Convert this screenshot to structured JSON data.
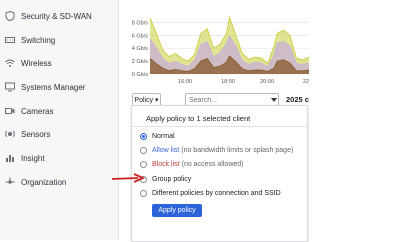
{
  "sidebar": {
    "items": [
      {
        "label": "Security & SD-WAN",
        "icon": "shield-icon"
      },
      {
        "label": "Switching",
        "icon": "switch-icon"
      },
      {
        "label": "Wireless",
        "icon": "wifi-icon"
      },
      {
        "label": "Systems Manager",
        "icon": "monitor-icon"
      },
      {
        "label": "Cameras",
        "icon": "camera-icon"
      },
      {
        "label": "Sensors",
        "icon": "sensor-icon"
      },
      {
        "label": "Insight",
        "icon": "bar-chart-icon"
      },
      {
        "label": "Organization",
        "icon": "network-icon"
      }
    ]
  },
  "chart_data": {
    "type": "area",
    "y_unit": "Gb/s",
    "yticks": [
      "8 Gb/s",
      "6 Gb/s",
      "4 Gb/s",
      "2 Gb/s",
      "0 Gb/s"
    ],
    "ylim": [
      0,
      9
    ],
    "xticks": [
      "16:00",
      "18:00",
      "20:00",
      "22"
    ],
    "x": [
      0,
      0.4,
      0.8,
      1.2,
      1.6,
      2,
      2.4,
      2.8,
      3.2,
      3.6,
      4,
      4.4,
      4.8,
      5,
      5.4,
      5.8,
      6.2,
      6.6,
      7,
      7.4,
      7.8,
      8,
      8.4,
      8.8,
      9.2,
      9.6,
      10
    ],
    "series": [
      {
        "color": "#c9ce3a",
        "values": [
          8.7,
          6.3,
          3.7,
          2.7,
          3.2,
          2.4,
          2.0,
          3.0,
          6.3,
          7.0,
          4.0,
          4.6,
          6.2,
          8.8,
          6.0,
          3.2,
          2.3,
          2.6,
          2.5,
          1.6,
          4.3,
          6.3,
          6.8,
          6.0,
          2.5,
          2.2,
          2.6
        ]
      },
      {
        "color": "#c7b0d8",
        "values": [
          5.5,
          4.0,
          2.4,
          1.6,
          1.9,
          1.5,
          1.2,
          2.1,
          4.6,
          5.0,
          2.6,
          3.3,
          4.6,
          5.9,
          4.3,
          2.0,
          1.5,
          1.8,
          1.7,
          1.1,
          2.9,
          4.8,
          5.0,
          4.3,
          1.6,
          1.5,
          1.7
        ]
      },
      {
        "color": "#8a5a2a",
        "values": [
          2.4,
          1.6,
          0.9,
          0.5,
          0.7,
          0.5,
          0.4,
          0.8,
          2.0,
          2.4,
          1.0,
          1.2,
          1.8,
          2.8,
          1.9,
          0.8,
          0.5,
          0.6,
          0.6,
          0.4,
          0.9,
          2.0,
          2.2,
          1.7,
          0.5,
          0.5,
          0.6
        ]
      }
    ]
  },
  "toolbar": {
    "policy_label": "Policy ▾",
    "search_placeholder": "Search...",
    "count_text": "2025 c"
  },
  "popup": {
    "title": "Apply policy to 1 selected client",
    "options": [
      {
        "label": "Normal",
        "selected": true
      },
      {
        "label": "Allow list",
        "sub": "(no bandwidth limits or splash page)"
      },
      {
        "label": "Block list",
        "sub": "(no access allowed)"
      },
      {
        "label": "Group policy"
      },
      {
        "label": "Different policies by connection and SSID"
      }
    ],
    "apply_label": "Apply policy"
  },
  "colors": {
    "accent": "#2d63d8",
    "annotation_arrow": "#cc2020"
  }
}
